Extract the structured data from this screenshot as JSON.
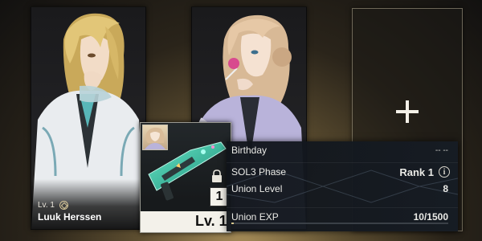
{
  "slots": [
    {
      "level": "Lv. 1",
      "name": "Luuk Herssen",
      "status": "filled"
    },
    {
      "status": "selected"
    },
    {
      "status": "empty"
    }
  ],
  "weapon": {
    "rank_number": "1",
    "level": "Lv. 1"
  },
  "info": {
    "birthday_label": "Birthday",
    "birthday_value": "-- --",
    "sol3_label": "SOL3 Phase",
    "sol3_value": "Rank 1",
    "union_level_label": "Union Level",
    "union_level_value": "8",
    "union_exp_label": "Union EXP",
    "union_exp_value": "10/1500",
    "union_exp_progress": 0.0067
  },
  "colors": {
    "accent_gold": "#d8c88e",
    "panel_bg": "#161c24"
  }
}
